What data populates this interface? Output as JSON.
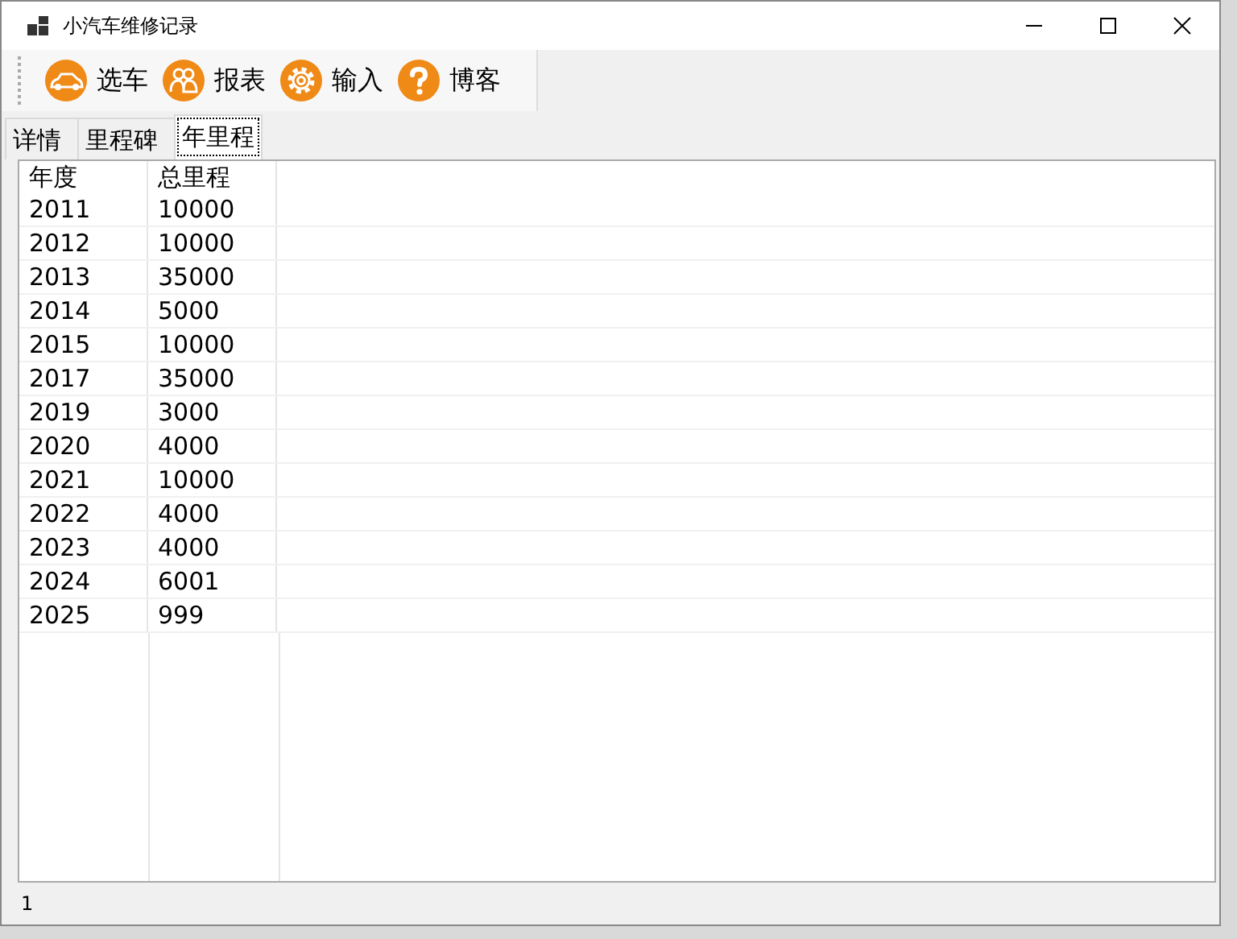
{
  "window": {
    "title": "小汽车维修记录"
  },
  "toolbar": [
    {
      "kind": "car",
      "label": "选车"
    },
    {
      "kind": "people",
      "label": "报表"
    },
    {
      "kind": "gear",
      "label": "输入"
    },
    {
      "kind": "help",
      "label": "博客"
    }
  ],
  "tabs": [
    {
      "label": "详情",
      "selected": false
    },
    {
      "label": "里程碑",
      "selected": false
    },
    {
      "label": "年里程",
      "selected": true
    }
  ],
  "table": {
    "columns": [
      "年度",
      "总里程"
    ],
    "rows": [
      [
        "2011",
        "10000"
      ],
      [
        "2012",
        "10000"
      ],
      [
        "2013",
        "35000"
      ],
      [
        "2014",
        "5000"
      ],
      [
        "2015",
        "10000"
      ],
      [
        "2017",
        "35000"
      ],
      [
        "2019",
        "3000"
      ],
      [
        "2020",
        "4000"
      ],
      [
        "2021",
        "10000"
      ],
      [
        "2022",
        "4000"
      ],
      [
        "2023",
        "4000"
      ],
      [
        "2024",
        "6001"
      ],
      [
        "2025",
        "999"
      ]
    ]
  },
  "status_bar": "1"
}
